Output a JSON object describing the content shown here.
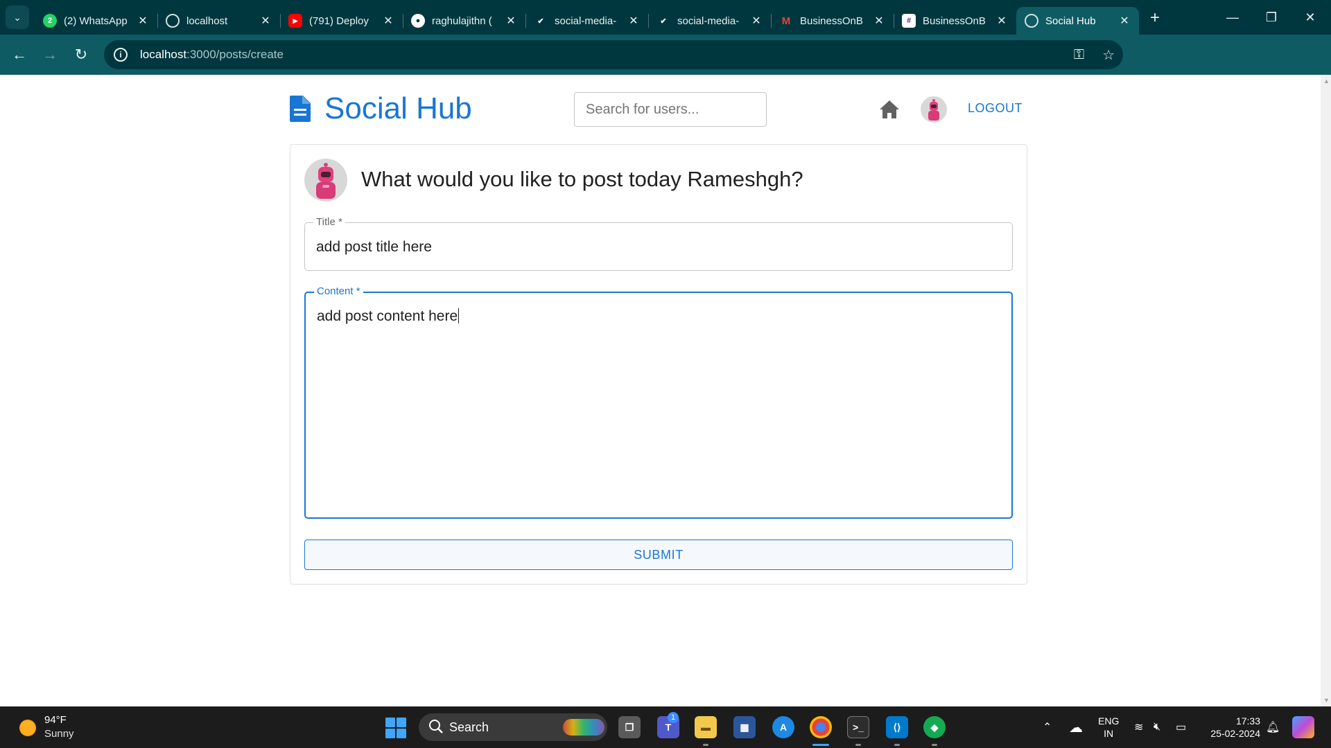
{
  "browser": {
    "tabs": [
      {
        "title": "(2) WhatsApp",
        "icon": "whatsapp-icon",
        "active": false
      },
      {
        "title": "localhost",
        "icon": "globe-icon",
        "active": false
      },
      {
        "title": "(791) Deploy",
        "icon": "youtube-icon",
        "active": false
      },
      {
        "title": "raghulajithn (",
        "icon": "github-icon",
        "active": false
      },
      {
        "title": "social-media-",
        "icon": "render-icon",
        "active": false
      },
      {
        "title": "social-media-",
        "icon": "render-icon",
        "active": false
      },
      {
        "title": "BusinessOnB",
        "icon": "gmail-icon",
        "active": false
      },
      {
        "title": "BusinessOnB",
        "icon": "slack-icon",
        "active": false
      },
      {
        "title": "Social Hub",
        "icon": "globe-icon",
        "active": true
      }
    ],
    "url_host": "localhost",
    "url_path": ":3000/posts/create"
  },
  "app": {
    "brand": "Social Hub",
    "search_placeholder": "Search for users...",
    "logout_label": "LOGOUT"
  },
  "form": {
    "prompt": "What would you like to post today Rameshgh?",
    "title_label": "Title *",
    "title_value": "add post title here",
    "content_label": "Content *",
    "content_value": "add post content here",
    "submit_label": "SUBMIT"
  },
  "taskbar": {
    "weather_temp": "94°F",
    "weather_condition": "Sunny",
    "search_label": "Search",
    "notification_count": "1",
    "lang_line1": "ENG",
    "lang_line2": "IN",
    "time": "17:33",
    "date": "25-02-2024"
  },
  "colors": {
    "accent": "#1976d2",
    "chrome_dark": "#00373f",
    "chrome_toolbar": "#0f5b64",
    "taskbar": "#1c1c1c"
  }
}
